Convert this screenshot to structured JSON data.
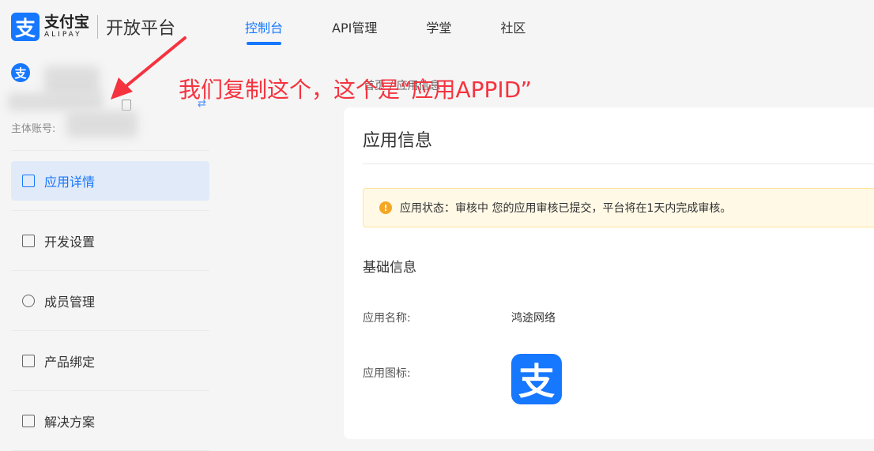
{
  "header": {
    "logo_mark": "支",
    "logo_cn": "支付宝",
    "logo_en": "ALIPAY",
    "platform": "开放平台",
    "nav": [
      {
        "label": "控制台",
        "active": true
      },
      {
        "label": "API管理"
      },
      {
        "label": "学堂"
      },
      {
        "label": "社区"
      }
    ]
  },
  "sidebar": {
    "app_icon": "支",
    "owner_label": "主体账号:",
    "menu": [
      {
        "label": "应用详情",
        "icon": "chart-icon",
        "active": true
      },
      {
        "label": "开发设置",
        "icon": "settings-window-icon"
      },
      {
        "label": "成员管理",
        "icon": "users-icon"
      },
      {
        "label": "产品绑定",
        "icon": "link-box-icon"
      },
      {
        "label": "解决方案",
        "icon": "solution-icon"
      }
    ]
  },
  "breadcrumb": "首页 / 应用信息",
  "main": {
    "title": "应用信息",
    "alert": {
      "text": "应用状态：审核中 您的应用审核已提交，平台将在1天内完成审核。",
      "icon": "exclamation-icon",
      "color": "#f5a623"
    },
    "section": "基础信息",
    "fields": [
      {
        "label": "应用名称:",
        "value": "鸿途网络"
      },
      {
        "label": "应用图标:"
      }
    ],
    "app_logo": "支"
  },
  "annotation": "我们复制这个，这个是“应用APPID”",
  "colors": {
    "accent": "#1677ff",
    "annotation": "#f5333f"
  }
}
